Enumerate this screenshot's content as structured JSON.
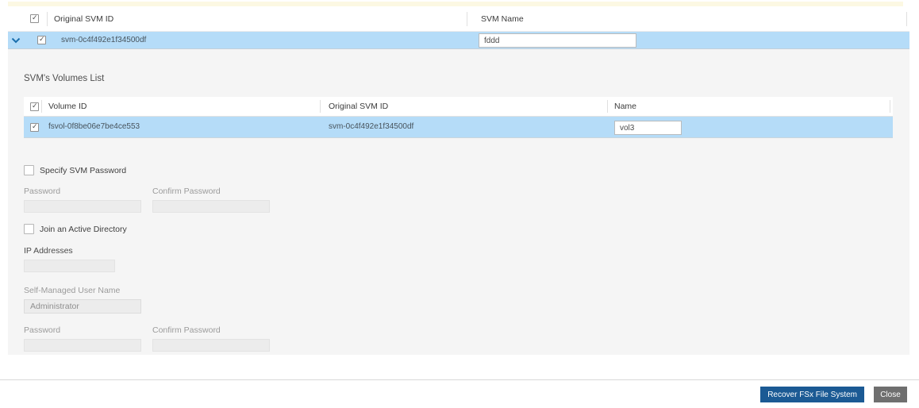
{
  "accent": {
    "top_bar_color": "#fcf8e3"
  },
  "svm_table": {
    "columns": [
      "Original SVM ID",
      "SVM Name"
    ],
    "rows": [
      {
        "original_svm_id": "svm-0c4f492e1f34500df",
        "svm_name_value": "fddd",
        "checked": true,
        "expanded": true
      }
    ],
    "header_checkbox_checked": true
  },
  "volumes": {
    "title": "SVM's Volumes List",
    "columns": [
      "Volume ID",
      "Original SVM ID",
      "Name"
    ],
    "header_checkbox_checked": true,
    "rows": [
      {
        "volume_id": "fsvol-0f8be06e7be4ce553",
        "original_svm_id": "svm-0c4f492e1f34500df",
        "name_value": "vol3",
        "checked": true
      }
    ]
  },
  "form": {
    "specify_svm_password_label": "Specify SVM Password",
    "specify_svm_password_checked": false,
    "password_label": "Password",
    "confirm_password_label": "Confirm Password",
    "password_value": "",
    "confirm_password_value": "",
    "join_ad_label": "Join an Active Directory",
    "join_ad_checked": false,
    "ip_addresses_label": "IP Addresses",
    "ip_addresses_value": "",
    "self_managed_user_name_label": "Self-Managed User Name",
    "self_managed_user_name_value": "Administrator",
    "ad_password_label": "Password",
    "ad_confirm_password_label": "Confirm Password",
    "ad_password_value": "",
    "ad_confirm_password_value": ""
  },
  "footer": {
    "recover_label": "Recover FSx File System",
    "close_label": "Close"
  },
  "colors": {
    "selected_row": "#b5dcf8",
    "primary_button": "#1b5a94",
    "secondary_button": "#6f6f6f",
    "panel_background": "#f5f5f5",
    "chevron": "#1c6fad"
  }
}
